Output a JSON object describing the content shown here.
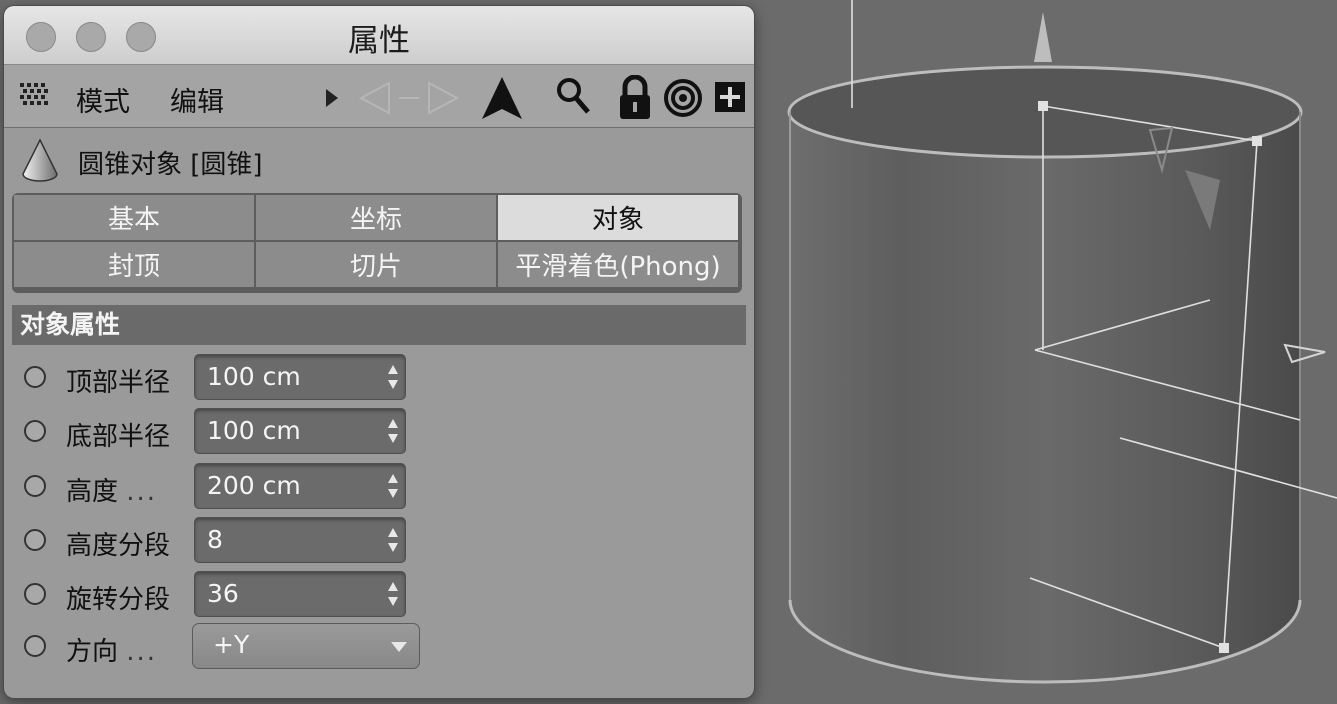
{
  "window": {
    "title": "属性"
  },
  "toolbar": {
    "mode_label": "模式",
    "edit_label": "编辑",
    "icons": [
      "grid-menu-icon",
      "play-arrow-icon",
      "navigation-arrows-icon",
      "up-arrow-icon",
      "search-icon",
      "lock-icon",
      "target-icon",
      "new-panel-icon"
    ]
  },
  "object": {
    "title": "圆锥对象 [圆锥]",
    "icon": "cone-icon"
  },
  "tabs": [
    {
      "label": "基本",
      "active": false
    },
    {
      "label": "坐标",
      "active": false
    },
    {
      "label": "对象",
      "active": true
    },
    {
      "label": "封顶",
      "active": false
    },
    {
      "label": "切片",
      "active": false
    },
    {
      "label": "平滑着色(Phong)",
      "active": false
    }
  ],
  "section": {
    "title": "对象属性"
  },
  "fields": [
    {
      "label": "顶部半径",
      "dots": "",
      "value": "100 cm"
    },
    {
      "label": "底部半径",
      "dots": "",
      "value": "100 cm"
    },
    {
      "label": "高度",
      "dots": "...",
      "value": "200 cm"
    },
    {
      "label": "高度分段",
      "dots": "",
      "value": "8"
    },
    {
      "label": "旋转分段",
      "dots": "",
      "value": "36"
    }
  ],
  "direction": {
    "label": "方向",
    "dots": "...",
    "value": "+Y"
  },
  "colors": {
    "panel_bg": "#9a9a9a",
    "active_tab": "#dcdcdc",
    "section_bar": "#6a6a6a"
  }
}
